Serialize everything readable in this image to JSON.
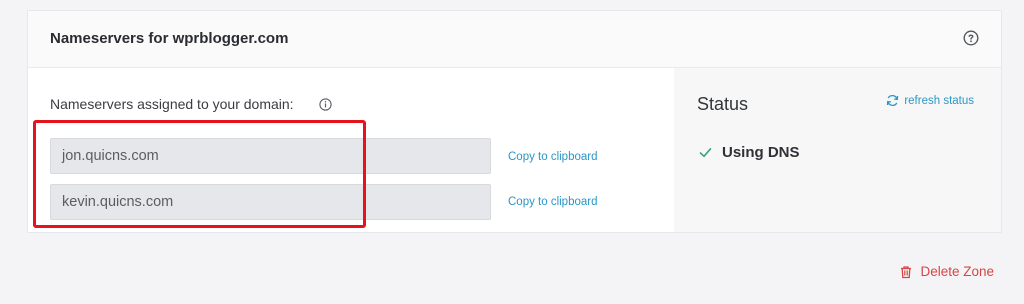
{
  "header": {
    "title": "Nameservers for wprblogger.com",
    "help_icon": "question-circle-icon"
  },
  "nameservers": {
    "label": "Nameservers assigned to your domain:",
    "info_icon": "info-circle-icon",
    "items": [
      {
        "value": "jon.quicns.com",
        "copy_label": "Copy to clipboard"
      },
      {
        "value": "kevin.quicns.com",
        "copy_label": "Copy to clipboard"
      }
    ]
  },
  "status": {
    "title": "Status",
    "refresh_label": "refresh status",
    "refresh_icon": "refresh-icon",
    "value": "Using DNS",
    "check_icon": "check-icon",
    "check_color": "#3aa57a"
  },
  "actions": {
    "delete_label": "Delete Zone",
    "delete_icon": "trash-icon",
    "delete_color": "#d74545"
  },
  "colors": {
    "accent": "#2a97c7",
    "highlight": "#e5131c"
  }
}
